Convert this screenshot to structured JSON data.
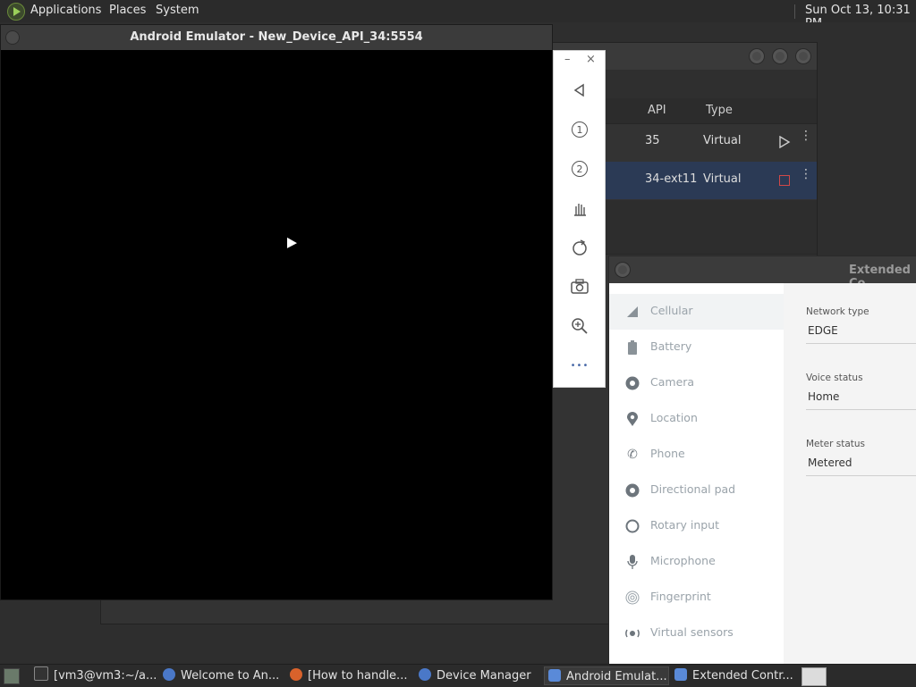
{
  "top_panel": {
    "menus": [
      "Applications",
      "Places",
      "System"
    ],
    "clock": "Sun Oct 13, 10:31 PM"
  },
  "device_manager": {
    "columns": {
      "api": "API",
      "type": "Type"
    },
    "rows": [
      {
        "api": "35",
        "type": "Virtual",
        "selected": false
      },
      {
        "api": "34-ext11",
        "type": "Virtual",
        "selected": true
      }
    ],
    "selected_row_color": "#2b3a55"
  },
  "emulator": {
    "title": "Android Emulator - New_Device_API_34:5554",
    "toolbar": {
      "minimize": "–",
      "close": "×",
      "buttons": [
        "back-icon",
        "rotate-left-icon",
        "rotate-right-icon",
        "touch-icon",
        "rotate-screen-icon",
        "camera-icon",
        "zoom-icon",
        "more-icon"
      ],
      "rotate_left_num": "1",
      "rotate_right_num": "2",
      "more_label": "•••"
    }
  },
  "extended_controls": {
    "title": "Extended Co",
    "nav": [
      {
        "label": "Cellular",
        "icon": "signal-icon"
      },
      {
        "label": "Battery",
        "icon": "battery-icon"
      },
      {
        "label": "Camera",
        "icon": "camera-aperture-icon"
      },
      {
        "label": "Location",
        "icon": "location-pin-icon"
      },
      {
        "label": "Phone",
        "icon": "phone-icon"
      },
      {
        "label": "Directional pad",
        "icon": "dpad-icon"
      },
      {
        "label": "Rotary input",
        "icon": "rotary-icon"
      },
      {
        "label": "Microphone",
        "icon": "microphone-icon"
      },
      {
        "label": "Fingerprint",
        "icon": "fingerprint-icon"
      },
      {
        "label": "Virtual sensors",
        "icon": "sensors-icon"
      }
    ],
    "fields": [
      {
        "label": "Network type",
        "value": "EDGE"
      },
      {
        "label": "Voice status",
        "value": "Home"
      },
      {
        "label": "Meter status",
        "value": "Metered"
      }
    ]
  },
  "taskbar": {
    "items": [
      {
        "label": "[vm3@vm3:~/a...",
        "icon": "terminal-icon",
        "active": false
      },
      {
        "label": "Welcome to An...",
        "icon": "android-studio-icon",
        "active": false
      },
      {
        "label": "[How to handle...",
        "icon": "firefox-icon",
        "active": false
      },
      {
        "label": "Device Manager",
        "icon": "android-studio-icon",
        "active": false
      },
      {
        "label": "Android Emulat...",
        "icon": "emulator-icon",
        "active": true
      },
      {
        "label": "Extended Contr...",
        "icon": "emulator-icon",
        "active": false
      }
    ]
  }
}
